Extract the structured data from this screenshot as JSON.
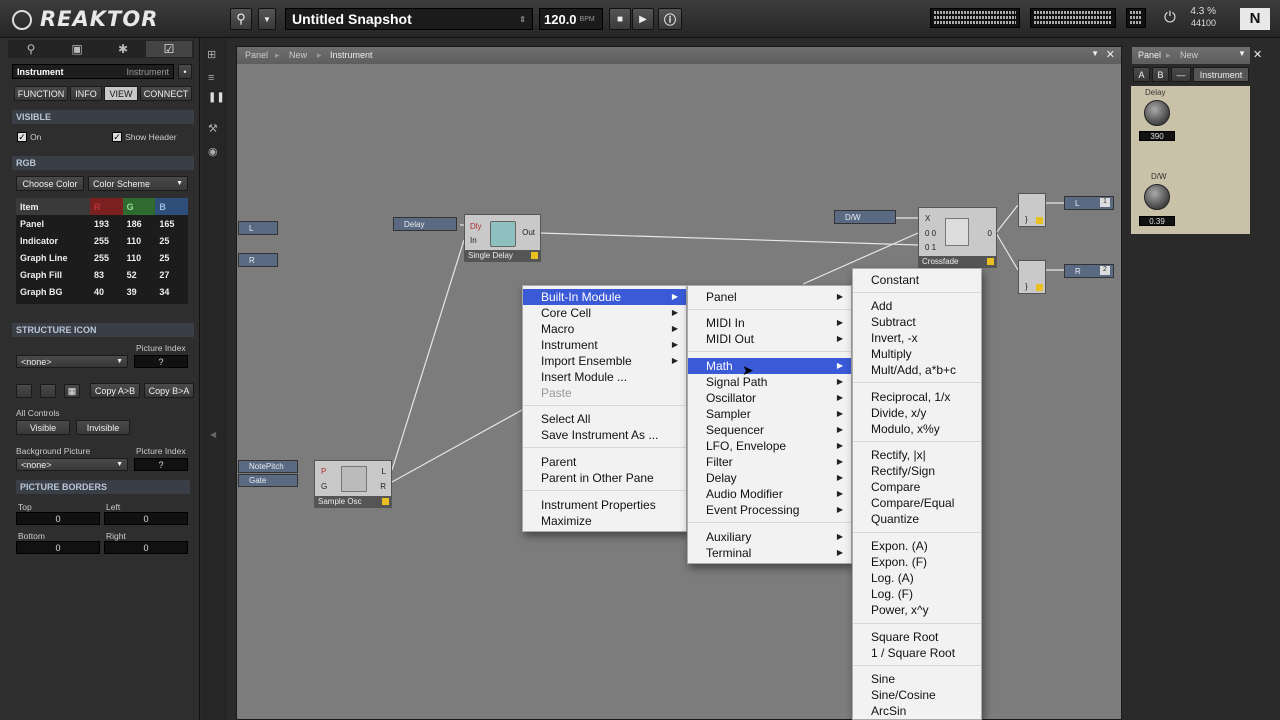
{
  "app": {
    "name": "REAKTOR"
  },
  "toolbar": {
    "snapshot_name": "Untitled Snapshot",
    "tempo": "120.0",
    "tempo_unit": "BPM",
    "cpu": "4.3 %",
    "sample_rate": "44100",
    "ni_logo": "N"
  },
  "inspector": {
    "name": "Instrument",
    "type": "Instrument",
    "tabs": [
      "FUNCTION",
      "INFO",
      "VIEW",
      "CONNECT"
    ],
    "active_tab": "VIEW",
    "visible_section": "VISIBLE",
    "on_label": "On",
    "show_header_label": "Show Header",
    "rgb_section": "RGB",
    "choose_color": "Choose Color",
    "color_scheme": "Color Scheme",
    "rgb_headers": [
      "Item",
      "R",
      "G",
      "B"
    ],
    "rgb_rows": [
      {
        "item": "Panel",
        "r": "193",
        "g": "186",
        "b": "165"
      },
      {
        "item": "Indicator",
        "r": "255",
        "g": "110",
        "b": "25"
      },
      {
        "item": "Graph Line",
        "r": "255",
        "g": "110",
        "b": "25"
      },
      {
        "item": "Graph Fill",
        "r": "83",
        "g": "52",
        "b": "27"
      },
      {
        "item": "Graph BG",
        "r": "40",
        "g": "39",
        "b": "34"
      }
    ],
    "structure_icon": "STRUCTURE ICON",
    "picture_index": "Picture Index",
    "none": "<none>",
    "q": "?",
    "copy_ab": "Copy A>B",
    "copy_ba": "Copy B>A",
    "all_controls": "All Controls",
    "visible_btn": "Visible",
    "invisible_btn": "Invisible",
    "background_picture": "Background Picture",
    "picture_borders": "PICTURE BORDERS",
    "top": "Top",
    "left": "Left",
    "bottom": "Bottom",
    "right": "Right",
    "top_val": "0",
    "left_val": "0",
    "bottom_val": "0",
    "right_val": "0"
  },
  "canvas": {
    "breadcrumb": [
      "Panel",
      "New",
      "Instrument"
    ],
    "modules": {
      "single_delay": "Single Delay",
      "sample_osc": "Sample Osc",
      "crossfade": "Crossfade",
      "delay_port": "Delay",
      "dw_port": "D/W",
      "notepitch": "NotePitch",
      "gate": "Gate",
      "in_l": "L",
      "in_r": "R",
      "out_l": "L",
      "out_r": "R",
      "out_l_num": "1",
      "out_r_num": "2",
      "dly": "Dly",
      "in": "In",
      "out": "Out",
      "p": "P",
      "g": "G",
      "sl": "L",
      "sr": "R",
      "x": "X",
      "x0": "0 0",
      "x1": "0 1",
      "zero": "0",
      "bracket": "}"
    }
  },
  "context_menu": {
    "items": [
      {
        "label": "Built-In Module",
        "submenu": true,
        "highlight": true
      },
      {
        "label": "Core Cell",
        "submenu": true
      },
      {
        "label": "Macro",
        "submenu": true
      },
      {
        "label": "Instrument",
        "submenu": true
      },
      {
        "label": "Import Ensemble",
        "submenu": true
      },
      {
        "label": "Insert Module ..."
      },
      {
        "label": "Paste",
        "disabled": true
      },
      {
        "label": "Select All"
      },
      {
        "label": "Save Instrument As ..."
      },
      {
        "label": "Parent"
      },
      {
        "label": "Parent in Other Pane"
      },
      {
        "label": "Instrument Properties"
      },
      {
        "label": "Maximize"
      }
    ]
  },
  "builtin_menu": {
    "items": [
      "Panel",
      "MIDI In",
      "MIDI Out",
      "Math",
      "Signal Path",
      "Oscillator",
      "Sampler",
      "Sequencer",
      "LFO, Envelope",
      "Filter",
      "Delay",
      "Audio Modifier",
      "Event Processing",
      "Auxiliary",
      "Terminal"
    ],
    "highlighted": "Math"
  },
  "math_menu": {
    "items": [
      "Constant",
      "Add",
      "Subtract",
      "Invert, -x",
      "Multiply",
      "Mult/Add, a*b+c",
      "Reciprocal, 1/x",
      "Divide, x/y",
      "Modulo, x%y",
      "Rectify, |x|",
      "Rectify/Sign",
      "Compare",
      "Compare/Equal",
      "Quantize",
      "Expon. (A)",
      "Expon. (F)",
      "Log. (A)",
      "Log. (F)",
      "Power, x^y",
      "Square Root",
      "1 / Square Root",
      "Sine",
      "Sine/Cosine",
      "ArcSin"
    ]
  },
  "panel": {
    "breadcrumb": [
      "Panel",
      "New"
    ],
    "a": "A",
    "b": "B",
    "dash": "—",
    "name": "Instrument",
    "delay_label": "Delay",
    "delay_value": "390",
    "dw_label": "D/W",
    "dw_value": "0.39"
  },
  "colors": {
    "accent": "#3a5ad8",
    "panel_bg": "#c9c2a8",
    "port": "#5a6a82",
    "indicator": "#e8c020"
  }
}
